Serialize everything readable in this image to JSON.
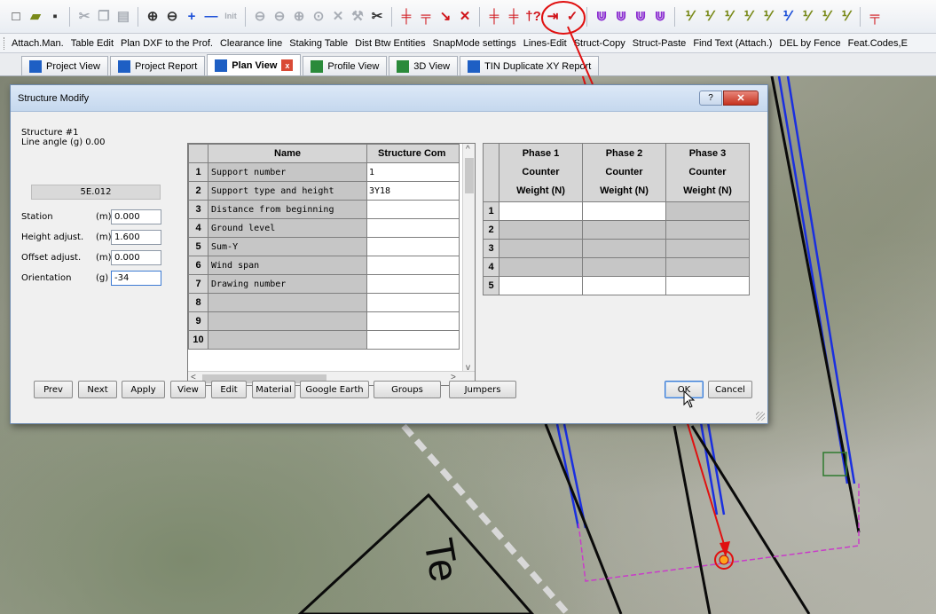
{
  "toolbar_icons": {
    "row": [
      {
        "icon": "new-file-icon",
        "glyph": "□",
        "color": "dk"
      },
      {
        "icon": "open-folder-icon",
        "glyph": "▰",
        "color": "olive"
      },
      {
        "icon": "save-icon",
        "glyph": "▪",
        "color": "dk"
      },
      {
        "sep": true
      },
      {
        "icon": "cut-icon",
        "glyph": "✂",
        "color": "gray"
      },
      {
        "icon": "copy-icon",
        "glyph": "❐",
        "color": "gray"
      },
      {
        "icon": "paste-icon",
        "glyph": "▤",
        "color": "gray"
      },
      {
        "sep": true
      },
      {
        "icon": "zoom-in-icon",
        "glyph": "⊕",
        "color": "dk"
      },
      {
        "icon": "zoom-out-icon",
        "glyph": "⊖",
        "color": "dk"
      },
      {
        "icon": "plus-icon",
        "glyph": "+",
        "color": "blue"
      },
      {
        "icon": "minus-icon",
        "glyph": "—",
        "color": "blue"
      },
      {
        "icon": "init-icon",
        "glyph": "Init",
        "color": "gray"
      },
      {
        "sep": true
      },
      {
        "icon": "pan-icon",
        "glyph": "⊖",
        "color": "gray"
      },
      {
        "icon": "rotate-icon",
        "glyph": "⊖",
        "color": "gray"
      },
      {
        "icon": "measure-icon",
        "glyph": "⊕",
        "color": "gray"
      },
      {
        "icon": "circle-icon",
        "glyph": "⊙",
        "color": "gray"
      },
      {
        "icon": "cross-icon",
        "glyph": "✕",
        "color": "gray"
      },
      {
        "icon": "tool-icon",
        "glyph": "⚒",
        "color": "gray"
      },
      {
        "icon": "scissors-icon",
        "glyph": "✂",
        "color": "dk"
      },
      {
        "sep": true
      },
      {
        "icon": "add-structure-icon",
        "glyph": "╪",
        "color": "red"
      },
      {
        "icon": "move-structure-icon",
        "glyph": "╤",
        "color": "red"
      },
      {
        "icon": "diagonal-icon",
        "glyph": "↘",
        "color": "red"
      },
      {
        "icon": "delete-structure-icon",
        "glyph": "✕",
        "color": "red"
      },
      {
        "sep": true
      },
      {
        "icon": "insert-icon",
        "glyph": "╪",
        "color": "red"
      },
      {
        "icon": "split-icon",
        "glyph": "╪",
        "color": "red"
      },
      {
        "icon": "structure-modify-icon",
        "glyph": "†?",
        "color": "red"
      },
      {
        "icon": "arrow-right-icon",
        "glyph": "⇥",
        "color": "red"
      },
      {
        "icon": "check-structure-icon",
        "glyph": "✓",
        "color": "red"
      },
      {
        "sep": true
      },
      {
        "icon": "phase-a-icon",
        "glyph": "⋓",
        "color": "purple"
      },
      {
        "icon": "phase-b-icon",
        "glyph": "⋓",
        "color": "purple"
      },
      {
        "icon": "phase-c-icon",
        "glyph": "⋓",
        "color": "purple"
      },
      {
        "icon": "phase-d-icon",
        "glyph": "⋓",
        "color": "purple"
      },
      {
        "sep": true
      },
      {
        "icon": "fraction-a-icon",
        "glyph": "⅟",
        "color": "olive"
      },
      {
        "icon": "fraction-b-icon",
        "glyph": "⅟",
        "color": "olive"
      },
      {
        "icon": "fraction-c-icon",
        "glyph": "⅟",
        "color": "olive"
      },
      {
        "icon": "fraction-d-icon",
        "glyph": "⅟",
        "color": "olive"
      },
      {
        "icon": "fraction-e-icon",
        "glyph": "⅟",
        "color": "olive"
      },
      {
        "icon": "fraction-f-icon",
        "glyph": "⅟",
        "color": "blue"
      },
      {
        "icon": "fraction-g-icon",
        "glyph": "⅟",
        "color": "olive"
      },
      {
        "icon": "fraction-h-icon",
        "glyph": "⅟",
        "color": "olive"
      },
      {
        "icon": "fraction-i-icon",
        "glyph": "⅟",
        "color": "olive"
      },
      {
        "sep": true
      },
      {
        "icon": "more-tools-icon",
        "glyph": "╤",
        "color": "red"
      }
    ]
  },
  "menu_row": [
    "Attach.Man.",
    "Table Edit",
    "Plan DXF to the Prof.",
    "Clearance line",
    "Staking Table",
    "Dist Btw Entities",
    "SnapMode settings",
    "Lines-Edit",
    "Struct-Copy",
    "Struct-Paste",
    "Find Text (Attach.)",
    "DEL by Fence",
    "Feat.Codes,E"
  ],
  "tabs": [
    {
      "label": "Project View",
      "icon": "project-view-icon",
      "color": "#1e5fc4"
    },
    {
      "label": "Project Report",
      "icon": "project-report-icon",
      "color": "#1e5fc4"
    },
    {
      "label": "Plan View",
      "icon": "plan-view-icon",
      "color": "#1e5fc4"
    },
    {
      "label": "Profile View",
      "icon": "profile-view-icon",
      "color": "#2a8a3a"
    },
    {
      "label": "3D View",
      "icon": "3d-view-icon",
      "color": "#2a8a3a"
    },
    {
      "label": "TIN Duplicate XY Report",
      "icon": "tin-report-icon",
      "color": "#1e5fc4"
    }
  ],
  "dialog": {
    "title": "Structure Modify",
    "help_label": "?",
    "close_label": "✕",
    "structure_label": "Structure #1",
    "line_angle": "Line angle (g) 0.00",
    "code": "5E.012",
    "fields": [
      {
        "label": "Station",
        "unit": "(m)",
        "value": "0.000"
      },
      {
        "label": "Height adjust.",
        "unit": "(m)",
        "value": "1.600"
      },
      {
        "label": "Offset adjust.",
        "unit": "(m)",
        "value": "0.000"
      },
      {
        "label": "Orientation",
        "unit": "(g)",
        "value": "-34"
      }
    ],
    "grid1": {
      "headers": [
        "Name",
        "Structure Com"
      ],
      "rows": [
        {
          "n": "1",
          "name": "Support  number",
          "value": "1"
        },
        {
          "n": "2",
          "name": "Support type and height",
          "value": "3Y18"
        },
        {
          "n": "3",
          "name": "Distance from beginning",
          "value": ""
        },
        {
          "n": "4",
          "name": "Ground level",
          "value": ""
        },
        {
          "n": "5",
          "name": "Sum-Y",
          "value": ""
        },
        {
          "n": "6",
          "name": "Wind span",
          "value": ""
        },
        {
          "n": "7",
          "name": "Drawing number",
          "value": ""
        },
        {
          "n": "8",
          "name": "",
          "value": ""
        },
        {
          "n": "9",
          "name": "",
          "value": ""
        },
        {
          "n": "10",
          "name": "",
          "value": ""
        }
      ]
    },
    "grid2": {
      "headers": [
        [
          "Phase 1",
          "Counter",
          "Weight (N)"
        ],
        [
          "Phase 2",
          "Counter",
          "Weight (N)"
        ],
        [
          "Phase 3",
          "Counter",
          "Weight (N)"
        ]
      ],
      "rows": [
        "1",
        "2",
        "3",
        "4",
        "5"
      ]
    },
    "buttons": [
      "Prev",
      "Next",
      "Apply",
      "View",
      "Edit",
      "Material",
      "Google Earth",
      "Groups",
      "Jumpers"
    ],
    "ok_label": "OK",
    "cancel_label": "Cancel"
  },
  "map_text": "Te",
  "colors": {
    "annotation": "#e01010",
    "conductor": "#1a2fe0",
    "boundary": "#c93cc9"
  }
}
